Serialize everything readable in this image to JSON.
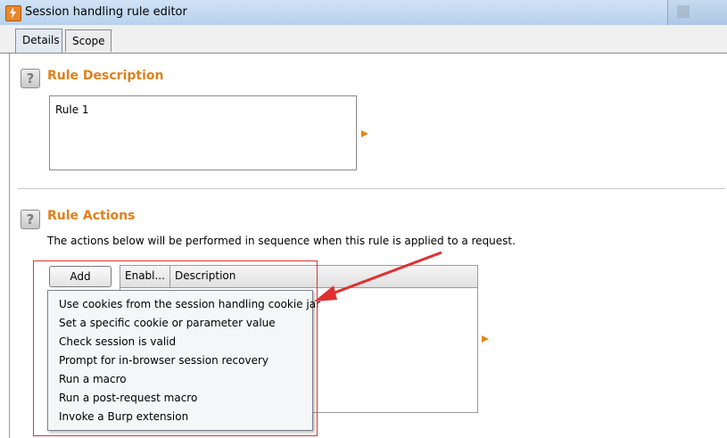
{
  "window": {
    "title": "Session handling rule editor"
  },
  "tabs": [
    {
      "label": "Details",
      "active": true
    },
    {
      "label": "Scope",
      "active": false
    }
  ],
  "rule_description": {
    "help_label": "?",
    "title": "Rule Description",
    "value": "Rule 1"
  },
  "rule_actions": {
    "help_label": "?",
    "title": "Rule Actions",
    "info": "The actions below will be performed in sequence when this rule is applied to a request.",
    "add_label": "Add",
    "columns": [
      "Enabl...",
      "Description"
    ],
    "menu_items": [
      "Use cookies from the session handling cookie jar",
      "Set a specific cookie or parameter value",
      "Check session is valid",
      "Prompt for in-browser session recovery",
      "Run a macro",
      "Run a post-request macro",
      "Invoke a Burp extension"
    ]
  },
  "colors": {
    "accent_orange": "#e0801a",
    "annotation_red": "#e03030",
    "titlebar_blue": "#cfe2f6"
  },
  "icons": [
    "burp-app-icon",
    "help-icon",
    "expand-arrow-icon"
  ]
}
